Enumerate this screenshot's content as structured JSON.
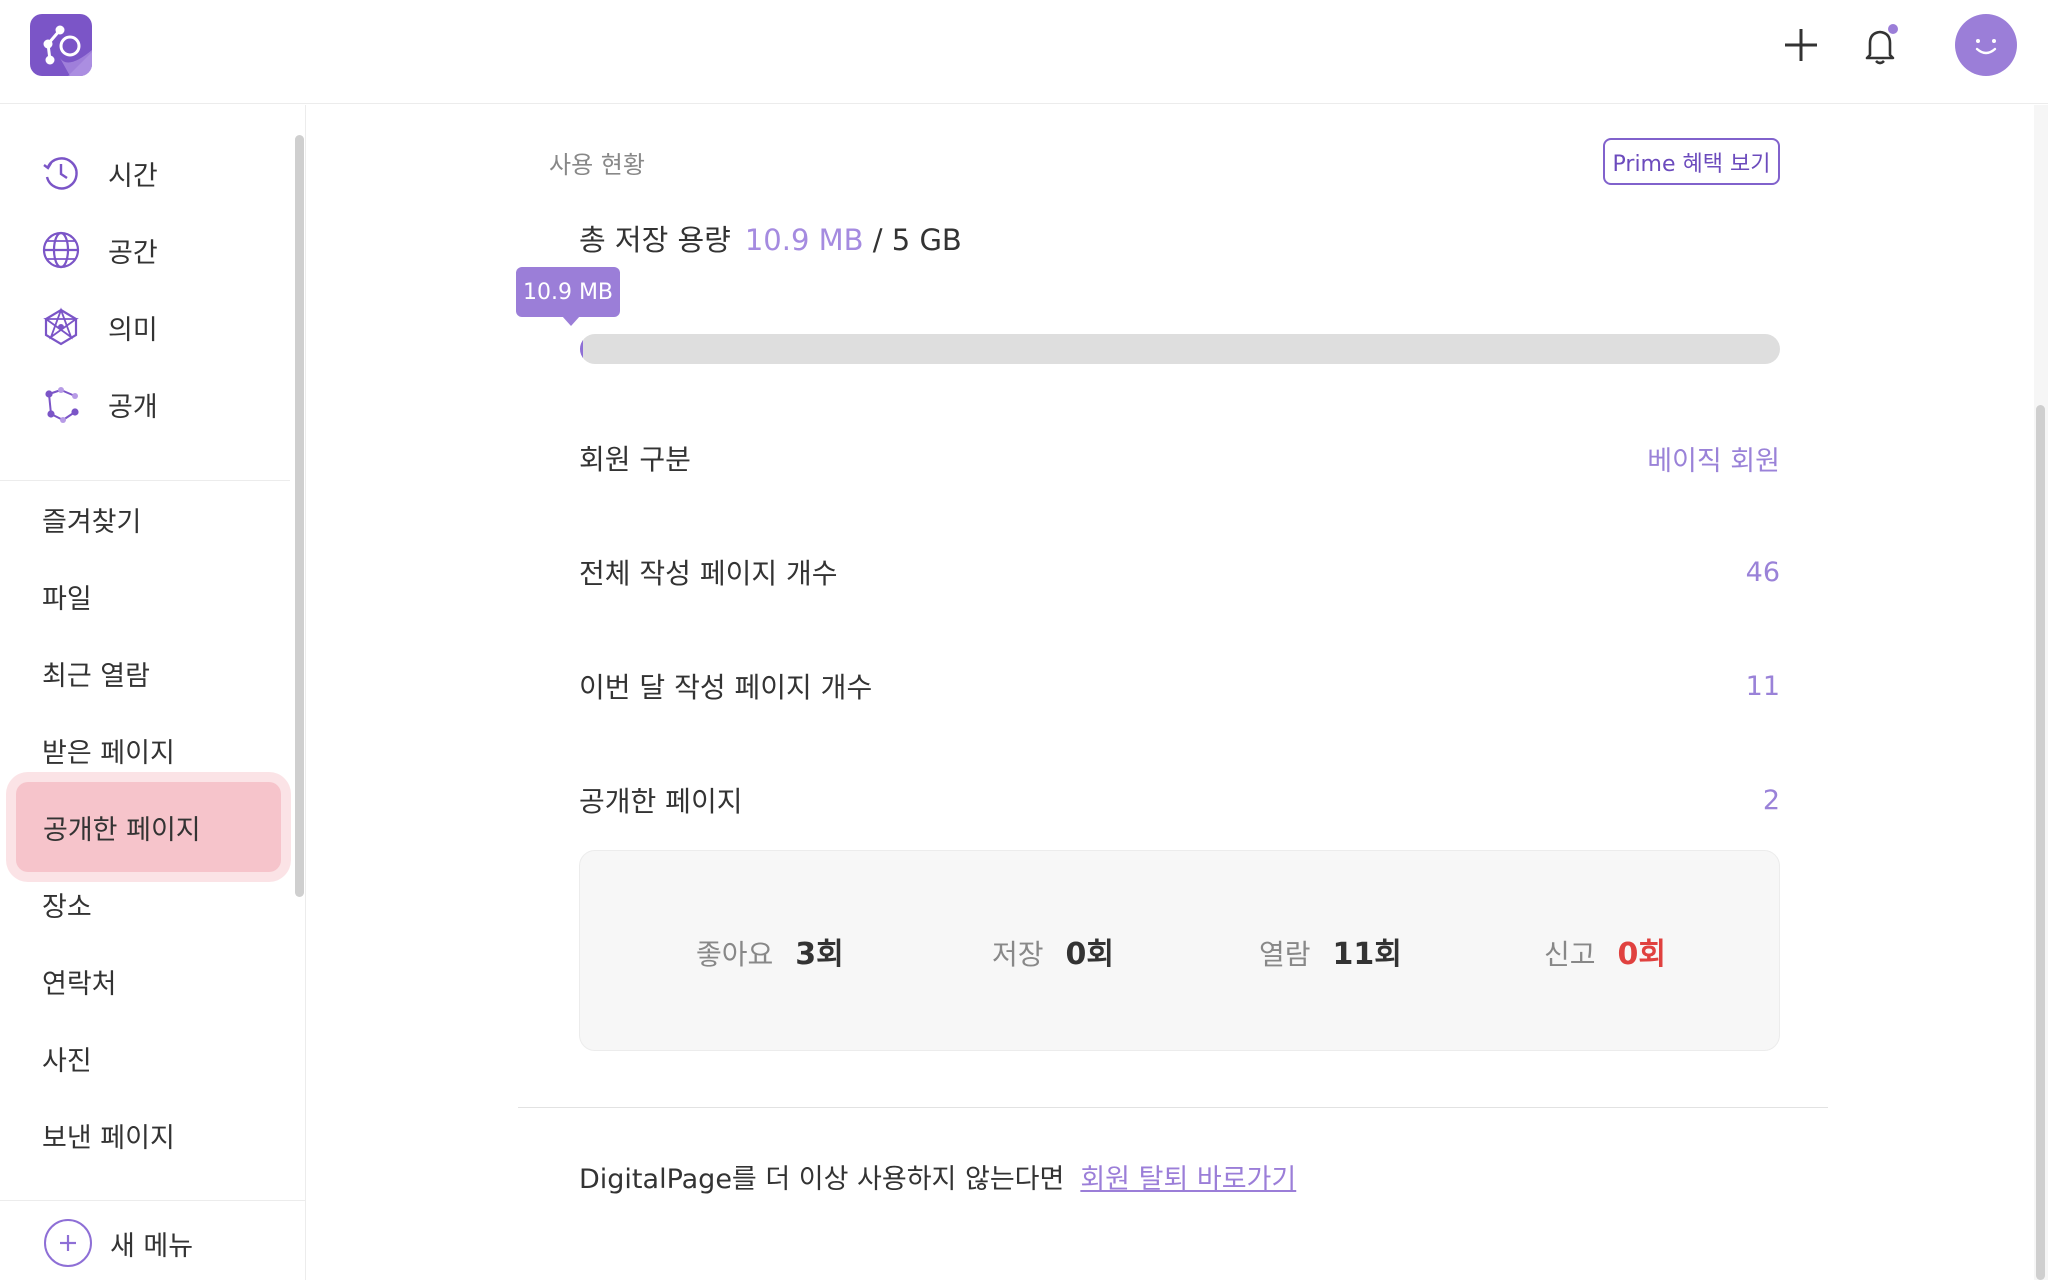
{
  "header": {
    "add_icon": "plus-icon",
    "bell_icon": "bell-icon",
    "has_notification": true,
    "brand_color": "#7b55c7"
  },
  "sidebar": {
    "primary": [
      {
        "label": "시간",
        "icon": "clock-history-icon"
      },
      {
        "label": "공간",
        "icon": "globe-icon"
      },
      {
        "label": "의미",
        "icon": "network-star-icon"
      },
      {
        "label": "공개",
        "icon": "share-graph-icon"
      }
    ],
    "secondary": [
      {
        "label": "즐겨찾기"
      },
      {
        "label": "파일"
      },
      {
        "label": "최근 열람"
      },
      {
        "label": "받은 페이지"
      },
      {
        "label": "공개한 페이지",
        "active": true
      },
      {
        "label": "장소"
      },
      {
        "label": "연락처"
      },
      {
        "label": "사진"
      },
      {
        "label": "보낸 페이지"
      }
    ],
    "new_menu_label": "새 메뉴"
  },
  "usage": {
    "section_title": "사용 현황",
    "prime_button": "Prime 혜택 보기",
    "storage_label": "총 저장 용량",
    "storage_used": "10.9 MB",
    "storage_total": "/ 5 GB",
    "tooltip": "10.9 MB",
    "progress_fraction": 0.002,
    "rows": [
      {
        "key": "회원 구분",
        "value": "베이직 회원"
      },
      {
        "key": "전체 작성 페이지 개수",
        "value": "46"
      },
      {
        "key": "이번 달 작성 페이지 개수",
        "value": "11"
      },
      {
        "key": "공개한 페이지",
        "value": "2"
      }
    ],
    "stats": [
      {
        "key": "좋아요",
        "value": "3회"
      },
      {
        "key": "저장",
        "value": "0회"
      },
      {
        "key": "열람",
        "value": "11회"
      },
      {
        "key": "신고",
        "value": "0회",
        "color": "#e0413f"
      }
    ]
  },
  "footer": {
    "text": "DigitalPage를 더 이상 사용하지 않는다면",
    "link": "회원 탈퇴 바로가기"
  }
}
